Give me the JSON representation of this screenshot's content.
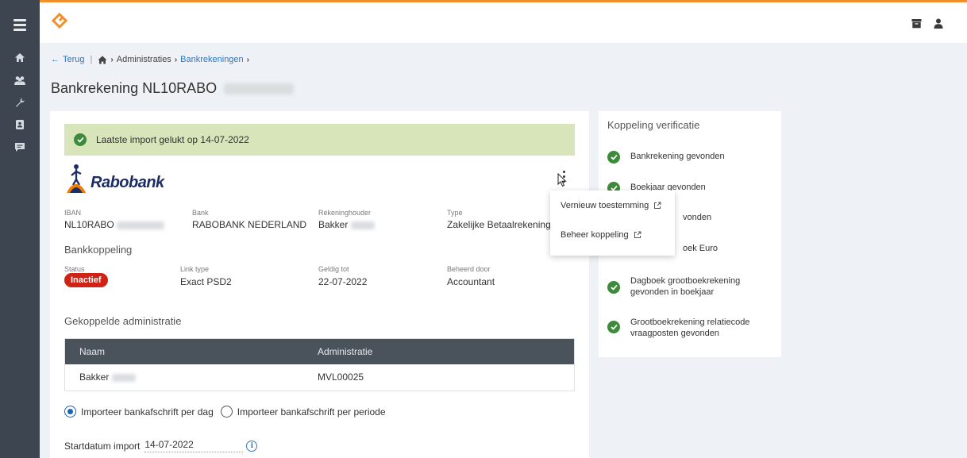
{
  "breadcrumb": {
    "back": "Terug",
    "items": [
      "Administraties",
      "Bankrekeningen"
    ],
    "separator": "›"
  },
  "page": {
    "title": "Bankrekening NL10RABO"
  },
  "card": {
    "banner": "Laatste import gelukt op 14-07-2022",
    "bank_logo_text": "Rabobank",
    "details": {
      "iban_label": "IBAN",
      "iban_value": "NL10RABO",
      "bank_label": "Bank",
      "bank_value": "RABOBANK NEDERLAND",
      "holder_label": "Rekeninghouder",
      "holder_value": "Bakker",
      "type_label": "Type",
      "type_value": "Zakelijke Betaalrekening"
    },
    "bankkoppeling": {
      "title": "Bankkoppeling",
      "status_label": "Status",
      "status_value": "Inactief",
      "link_label": "Link type",
      "link_value": "Exact PSD2",
      "valid_label": "Geldig tot",
      "valid_value": "22-07-2022",
      "managed_label": "Beheerd door",
      "managed_value": "Accountant"
    },
    "linked": {
      "title": "Gekoppelde administratie",
      "columns": [
        "Naam",
        "Administratie"
      ],
      "rows": [
        {
          "naam": "Bakker",
          "administratie": "MVL00025"
        }
      ]
    },
    "import_options": {
      "per_day": "Importeer bankafschrift per dag",
      "per_period": "Importeer bankafschrift per periode",
      "selected": "per_day"
    },
    "start": {
      "label": "Startdatum import",
      "value": "14-07-2022"
    }
  },
  "menu": {
    "items": [
      "Vernieuw toestemming",
      "Beheer koppeling"
    ]
  },
  "verification": {
    "title": "Koppeling verificatie",
    "items": [
      "Bankrekening gevonden",
      "Boekjaar gevonden",
      "vonden",
      "oek Euro",
      "Dagboek grootboekrekening gevonden in boekjaar",
      "Grootboekrekening relatiecode vraagposten gevonden"
    ]
  },
  "colors": {
    "accent": "#f0902a",
    "success": "#3c8a3a",
    "danger": "#d12216",
    "link": "#2a79c4",
    "sidebar": "#3d4650",
    "banner": "#d8e4b9"
  }
}
